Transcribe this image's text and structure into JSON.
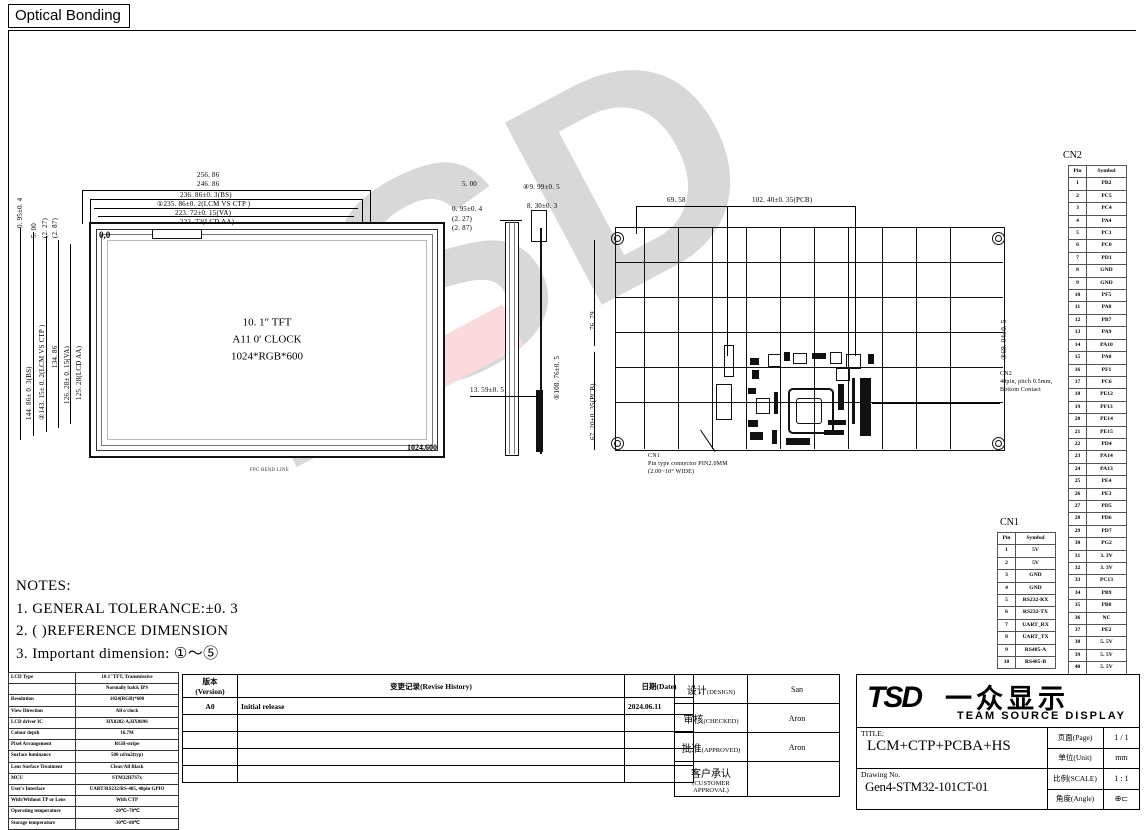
{
  "header": {
    "tab_label": "Optical Bonding"
  },
  "front_view": {
    "line1": "10. 1″ TFT",
    "line2": "A11  0′ CLOCK",
    "line3": "1024*RGB*600",
    "origin_label": "0,0",
    "corner_label": "1024,600",
    "fpc_label": "FPC BEND LINE",
    "dims_top": [
      "256. 86",
      "246. 86",
      "236. 86±0. 3(BS)",
      "①235. 86±0. 2(LCM VS CTP )",
      "223. 72±0. 15(VA)",
      "222. 72(LCD AA)"
    ],
    "dims_left": [
      "144. 86± 0. 3(BS)",
      "②143. 15± 0. 2(LCM VS CTP )",
      "134. 86",
      "126. 28± 0. 15(VA)",
      "125. 28(LCD AA)"
    ]
  },
  "side_view": {
    "dims": [
      "5. 00",
      "0. 95±0. 4",
      "(2. 27)",
      "(2. 87)",
      "④9. 99±0. 5",
      "8. 30±0. 3",
      "⑤108. 76±0. 5",
      "13. 59±0. 5"
    ]
  },
  "back_view": {
    "dims": [
      "69. 58",
      "102. 40±0. 35(PCB)",
      "76. 79",
      "67. 20±0. 35(PCB)",
      "③69. 04±0. 5"
    ],
    "cn1_note": [
      "CN1",
      "Pin type connector PIN2.0MM",
      "(2.00~10° WIDE)"
    ],
    "cn2_note": [
      "CN2",
      "40pin, pitch 0.5mm,",
      "Bottom Contact"
    ]
  },
  "cn2": {
    "title": "CN2",
    "headers": [
      "Pin",
      "Symbol"
    ],
    "rows": [
      [
        "1",
        "PB2"
      ],
      [
        "2",
        "PC5"
      ],
      [
        "3",
        "PC4"
      ],
      [
        "4",
        "PA4"
      ],
      [
        "5",
        "PC1"
      ],
      [
        "6",
        "PC0"
      ],
      [
        "7",
        "PD1"
      ],
      [
        "8",
        "GND"
      ],
      [
        "9",
        "GND"
      ],
      [
        "10",
        "PF5"
      ],
      [
        "11",
        "PA8"
      ],
      [
        "12",
        "PB7"
      ],
      [
        "13",
        "PA9"
      ],
      [
        "14",
        "PA10"
      ],
      [
        "15",
        "PA0"
      ],
      [
        "16",
        "PF1"
      ],
      [
        "17",
        "PC6"
      ],
      [
        "18",
        "PE12"
      ],
      [
        "19",
        "PF13"
      ],
      [
        "20",
        "PE14"
      ],
      [
        "21",
        "PE15"
      ],
      [
        "22",
        "PD4"
      ],
      [
        "23",
        "PA14"
      ],
      [
        "24",
        "PA13"
      ],
      [
        "25",
        "PE4"
      ],
      [
        "26",
        "PE3"
      ],
      [
        "27",
        "PD5"
      ],
      [
        "28",
        "PD6"
      ],
      [
        "29",
        "PD7"
      ],
      [
        "30",
        "PG2"
      ],
      [
        "31",
        "3. 3V"
      ],
      [
        "32",
        "3. 3V"
      ],
      [
        "33",
        "PC13"
      ],
      [
        "34",
        "PB9"
      ],
      [
        "35",
        "PB8"
      ],
      [
        "36",
        "NC"
      ],
      [
        "37",
        "PE2"
      ],
      [
        "38",
        "5. 5V"
      ],
      [
        "39",
        "5. 5V"
      ],
      [
        "40",
        "5. 5V"
      ]
    ]
  },
  "cn1": {
    "title": "CN1",
    "headers": [
      "Pin",
      "Symbol"
    ],
    "rows": [
      [
        "1",
        "5V"
      ],
      [
        "2",
        "5V"
      ],
      [
        "3",
        "GND"
      ],
      [
        "4",
        "GND"
      ],
      [
        "5",
        "RS232-RX"
      ],
      [
        "6",
        "RS232-TX"
      ],
      [
        "7",
        "UART_RX"
      ],
      [
        "8",
        "UART_TX"
      ],
      [
        "9",
        "RS485-A"
      ],
      [
        "10",
        "RS485-B"
      ]
    ]
  },
  "notes": {
    "title": "NOTES:",
    "items": [
      "1. GENERAL  TOLERANCE:±0. 3",
      "2. (  )REFERENCE  DIMENSION",
      "3. Important  dimension:  ①〜⑤"
    ]
  },
  "spec_table": {
    "rows": [
      [
        "LCD Type",
        "10.1\"TFT, Transmissive"
      ],
      [
        "",
        "Normally balck IPS"
      ],
      [
        "Resolution",
        "1024(RGB)*600"
      ],
      [
        "View Direction",
        "All o'clock"
      ],
      [
        "LCD driver IC",
        "HX8282-A,HX8696"
      ],
      [
        "Colour depth",
        "16.7M"
      ],
      [
        "Pixel Arrangement",
        "RGB-stripe"
      ],
      [
        "Surface luminance",
        "500 cd/m2(typ)"
      ],
      [
        "Lens Surface Treatment",
        "Clear/All Black"
      ],
      [
        "MCU",
        "STM32H7S7x"
      ],
      [
        "User's Interface",
        "UART/RS232/RS-485, 40pin GPIO"
      ],
      [
        "With/Without TP or Lens",
        "With CTP"
      ],
      [
        "Operating temperature",
        "-20℃~70℃"
      ],
      [
        "Storage temperature",
        "-30℃~80℃"
      ]
    ]
  },
  "revision": {
    "headers": [
      "版本\n(Version)",
      "变更记录(Revise History)",
      "日期(Date)"
    ],
    "header_version": "版本",
    "header_version_en": "(Version)",
    "header_history_cn": "变更记录",
    "header_history_en": "(Revise History)",
    "header_date": "日期(Date)",
    "rows": [
      [
        "A0",
        "Initial release",
        "2024.06.11"
      ],
      [
        "",
        "",
        ""
      ],
      [
        "",
        "",
        ""
      ],
      [
        "",
        "",
        ""
      ],
      [
        "",
        "",
        ""
      ]
    ]
  },
  "approval": {
    "rows": [
      {
        "label_cn": "设计",
        "label_en": "(DESIGN)",
        "value": "San"
      },
      {
        "label_cn": "审核",
        "label_en": "(CHECKED)",
        "value": "Aron"
      },
      {
        "label_cn": "批准",
        "label_en": "(APPROVED)",
        "value": "Aron"
      },
      {
        "label_cn": "客户承认",
        "label_en": "(CUSTOMER APPROVAL)",
        "value": ""
      }
    ]
  },
  "title_block": {
    "company_cn": "一众显示",
    "company_en": "TEAM SOURCE DISPLAY",
    "logo_text": "TSD",
    "title_key": "TITLE:",
    "title_value": "LCM+CTP+PCBA+HS",
    "drawing_key": "Drawing No.",
    "drawing_value": "Gen4-STM32-101CT-01",
    "rows": [
      {
        "key": "页面(Page)",
        "value": "1 / 1"
      },
      {
        "key": "单位(Unit)",
        "value": "mm"
      },
      {
        "key": "比例(SCALE)",
        "value": "1 : 1"
      },
      {
        "key": "角度(Angle)",
        "value": "⊕⊏"
      }
    ]
  },
  "watermark": {
    "text": "TSD"
  }
}
